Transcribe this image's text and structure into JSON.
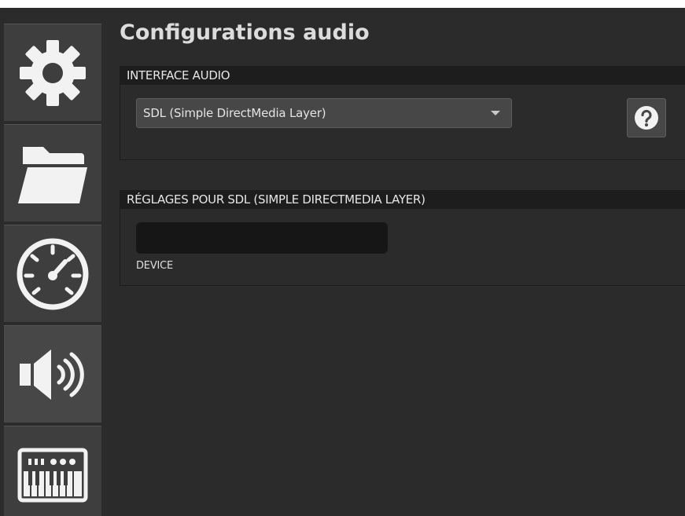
{
  "page": {
    "title": "Configurations audio"
  },
  "sidebar": {
    "items": [
      {
        "icon": "gear-icon",
        "active": false
      },
      {
        "icon": "folder-icon",
        "active": false
      },
      {
        "icon": "speedometer-icon",
        "active": false
      },
      {
        "icon": "speaker-icon",
        "active": true
      },
      {
        "icon": "midi-keyboard-icon",
        "active": false
      }
    ]
  },
  "interface_section": {
    "header": "INTERFACE AUDIO",
    "selected_driver": "SDL (Simple DirectMedia Layer)",
    "help_icon": "question-mark-icon"
  },
  "settings_section": {
    "header": "RÉGLAGES POUR SDL (SIMPLE DIRECTMEDIA LAYER)",
    "device_value": "",
    "device_label": "DEVICE"
  },
  "colors": {
    "background": "#2b2b2b",
    "header_bar": "#1d1d1d",
    "button": "#3e3e3e",
    "text": "#dcdcdc"
  }
}
